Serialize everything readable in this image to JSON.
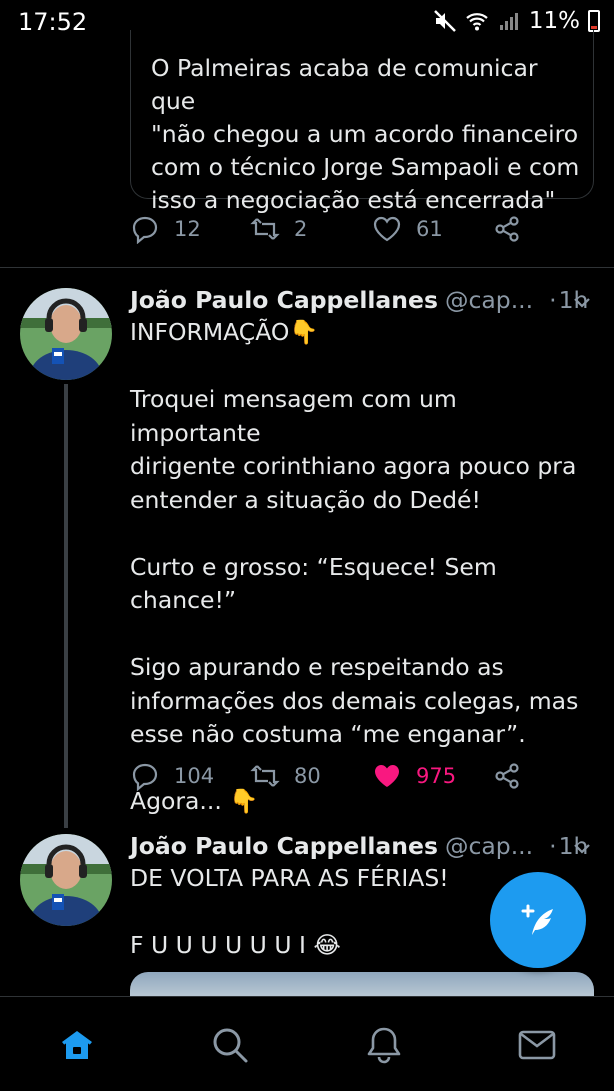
{
  "status_bar": {
    "time": "17:52",
    "battery_percent": "11%",
    "icons": [
      "mute-icon",
      "wifi-icon",
      "signal-icon",
      "battery-icon"
    ]
  },
  "quoted_tweet": {
    "text": "O Palmeiras acaba de comunicar que\n\"não chegou a um acordo financeiro\ncom o técnico Jorge Sampaoli e com\nisso a negociação está encerrada\""
  },
  "prev_actions": {
    "replies": "12",
    "retweets": "2",
    "likes": "61"
  },
  "tweet1": {
    "name": "João Paulo Cappellanes",
    "handle": "@cap...",
    "dot": "·",
    "time": "1h",
    "body": "INFORMAÇÃO👇\n\nTroquei mensagem com um importante\ndirigente corinthiano agora pouco pra\nentender a situação do Dedé!\n\nCurto e grosso: “Esquece! Sem chance!”\n\nSigo apurando e respeitando as\ninformações dos demais colegas, mas\nesse não costuma “me enganar”.\n\nAgora... 👇",
    "replies": "104",
    "retweets": "80",
    "likes": "975",
    "liked": true
  },
  "tweet2": {
    "name": "João Paulo Cappellanes",
    "handle": "@cap...",
    "dot": "·",
    "time": "1h",
    "body": "DE VOLTA PARA AS FÉRIAS!\n\nF U U U U U U I 😂"
  },
  "colors": {
    "accent": "#1d9bf0",
    "like": "#f91880",
    "muted": "#8b98a5",
    "background": "#000000"
  },
  "bottom_nav": [
    "home-icon",
    "search-icon",
    "notifications-icon",
    "messages-icon"
  ],
  "fab_icon": "compose-icon"
}
